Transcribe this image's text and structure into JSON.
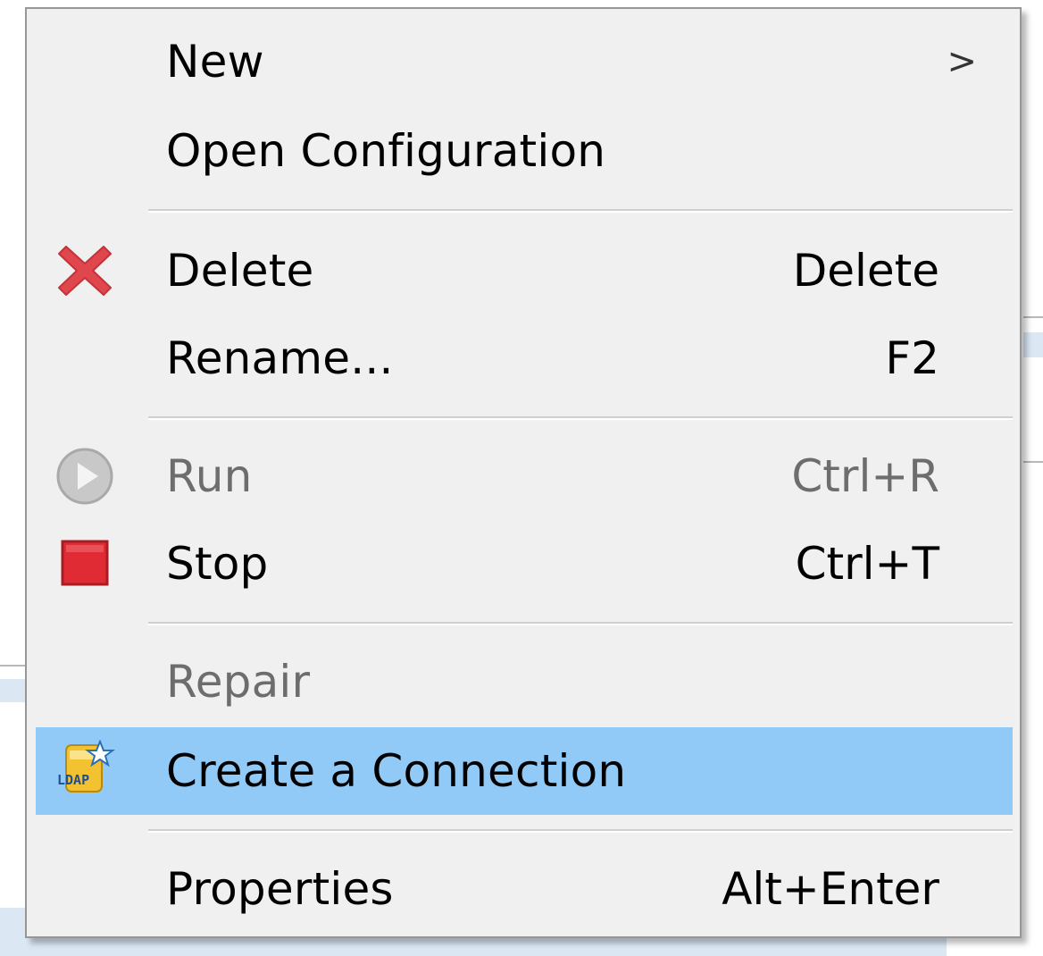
{
  "menu": {
    "items": [
      {
        "label": "New",
        "shortcut": "",
        "submenu_glyph": ">",
        "icon": "",
        "enabled": true
      },
      {
        "label": "Open Configuration",
        "shortcut": "",
        "icon": "",
        "enabled": true
      },
      {
        "label": "Delete",
        "shortcut": "Delete",
        "icon": "delete-x-icon",
        "enabled": true
      },
      {
        "label": "Rename...",
        "shortcut": "F2",
        "icon": "",
        "enabled": true
      },
      {
        "label": "Run",
        "shortcut": "Ctrl+R",
        "icon": "run-play-icon",
        "enabled": false
      },
      {
        "label": "Stop",
        "shortcut": "Ctrl+T",
        "icon": "stop-square-icon",
        "enabled": true
      },
      {
        "label": "Repair",
        "shortcut": "",
        "icon": "",
        "enabled": false
      },
      {
        "label": "Create a Connection",
        "shortcut": "",
        "icon": "ldap-connection-icon",
        "enabled": true,
        "highlighted": true
      },
      {
        "label": "Properties",
        "shortcut": "Alt+Enter",
        "icon": "",
        "enabled": true
      }
    ],
    "icon_text": {
      "ldap": "LDAP"
    }
  },
  "colors": {
    "menu_background": "#f0f0f0",
    "highlight": "#91c9f7",
    "disabled_text": "#6d6d6d",
    "delete_icon": "#e0474c",
    "stop_icon": "#e02b35",
    "run_icon": "#bdbdbd"
  }
}
